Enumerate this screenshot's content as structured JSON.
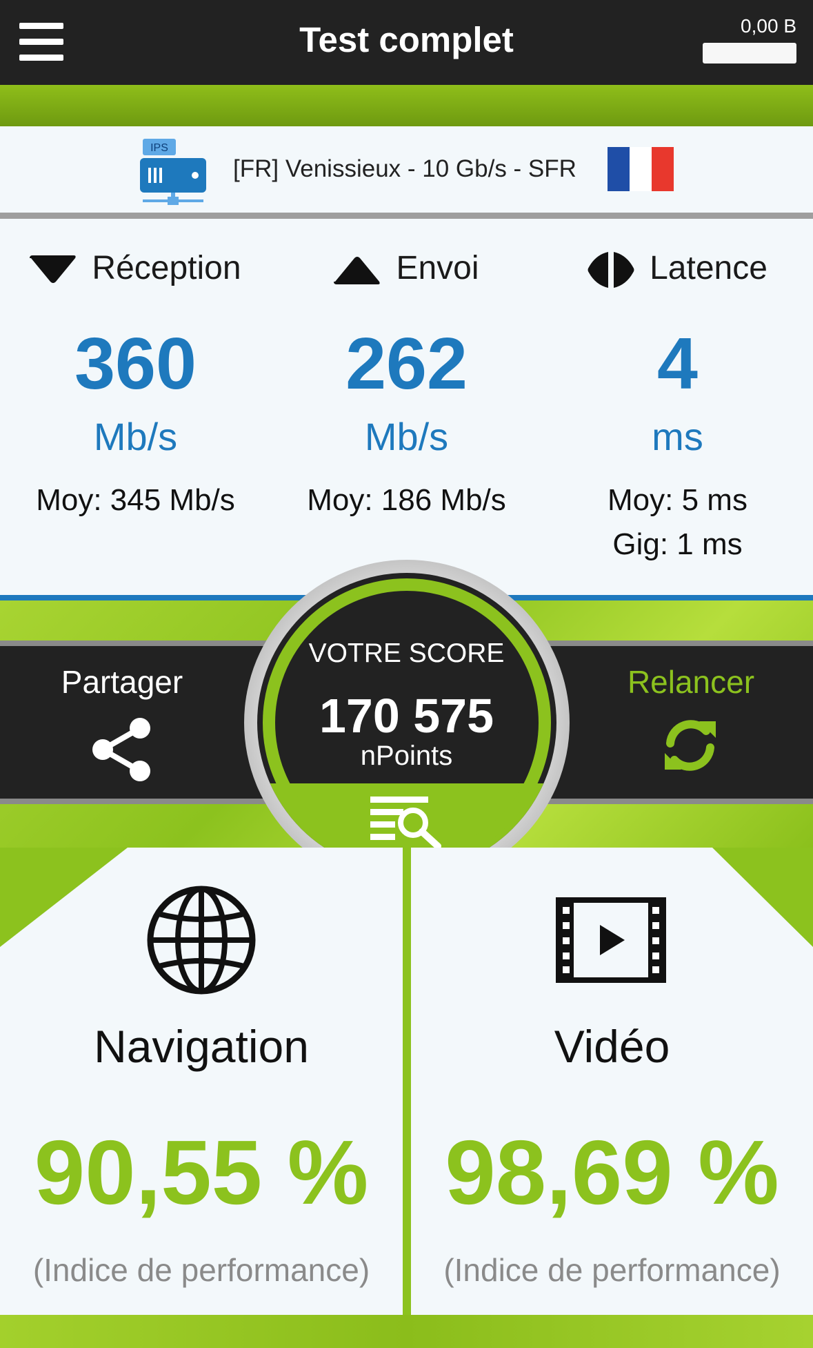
{
  "header": {
    "title": "Test complet",
    "data_counter": "0,00 B"
  },
  "server": {
    "icon_label": "IPS",
    "name": "[FR] Venissieux - 10 Gb/s - SFR",
    "flag_colors": [
      "#1f4ea7",
      "#ffffff",
      "#e8382d"
    ]
  },
  "stats": {
    "reception": {
      "label": "Réception",
      "value": "360",
      "unit": "Mb/s",
      "avg": "Moy: 345 Mb/s"
    },
    "upload": {
      "label": "Envoi",
      "value": "262",
      "unit": "Mb/s",
      "avg": "Moy: 186 Mb/s"
    },
    "latency": {
      "label": "Latence",
      "value": "4",
      "unit": "ms",
      "avg": "Moy: 5 ms",
      "jitter": "Gig: 1 ms"
    }
  },
  "actions": {
    "share_label": "Partager",
    "relaunch_label": "Relancer"
  },
  "score": {
    "title": "VOTRE SCORE",
    "value": "170 575",
    "unit": "nPoints"
  },
  "cards": {
    "navigation": {
      "title": "Navigation",
      "value": "90,55 %",
      "note": "(Indice de performance)"
    },
    "video": {
      "title": "Vidéo",
      "value": "98,69 %",
      "note": "(Indice de performance)"
    }
  },
  "colors": {
    "accent_green": "#8cc21e",
    "accent_blue": "#1e79bd",
    "dark": "#222222"
  }
}
